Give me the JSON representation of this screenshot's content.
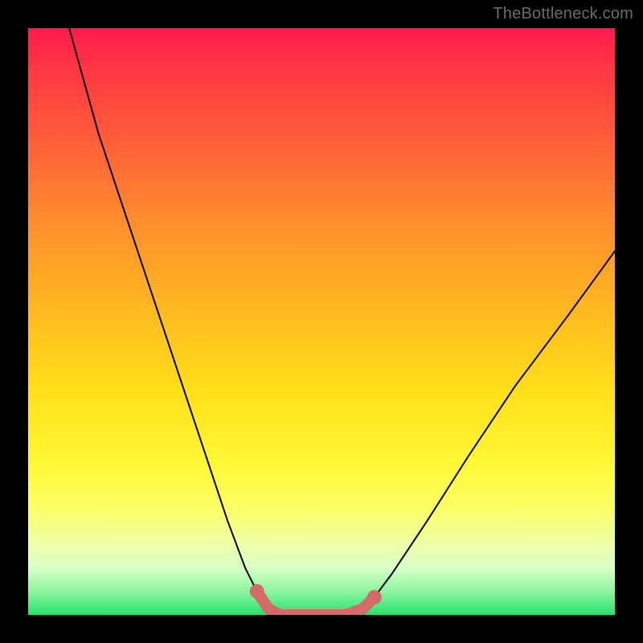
{
  "watermark": "TheBottleneck.com",
  "chart_data": {
    "type": "line",
    "title": "",
    "xlabel": "",
    "ylabel": "",
    "xlim": [
      0,
      100
    ],
    "ylim": [
      0,
      100
    ],
    "series": [
      {
        "name": "bottleneck-curve",
        "x": [
          7,
          12,
          18,
          24,
          30,
          34,
          37,
          39,
          41,
          43,
          46,
          50,
          54,
          57,
          59,
          62,
          68,
          75,
          83,
          92,
          100
        ],
        "values": [
          100,
          82,
          64,
          46,
          28,
          16,
          8,
          4,
          1,
          0,
          0,
          0,
          0,
          1,
          3,
          7,
          16,
          27,
          39,
          51,
          62
        ]
      }
    ],
    "marker_segment": {
      "name": "optimal-range",
      "x": [
        39,
        41,
        43,
        46,
        50,
        54,
        57,
        59
      ],
      "values": [
        4,
        1,
        0,
        0,
        0,
        0,
        1,
        3
      ]
    }
  },
  "colors": {
    "curve": "#000000",
    "marker": "#d46a6a"
  }
}
